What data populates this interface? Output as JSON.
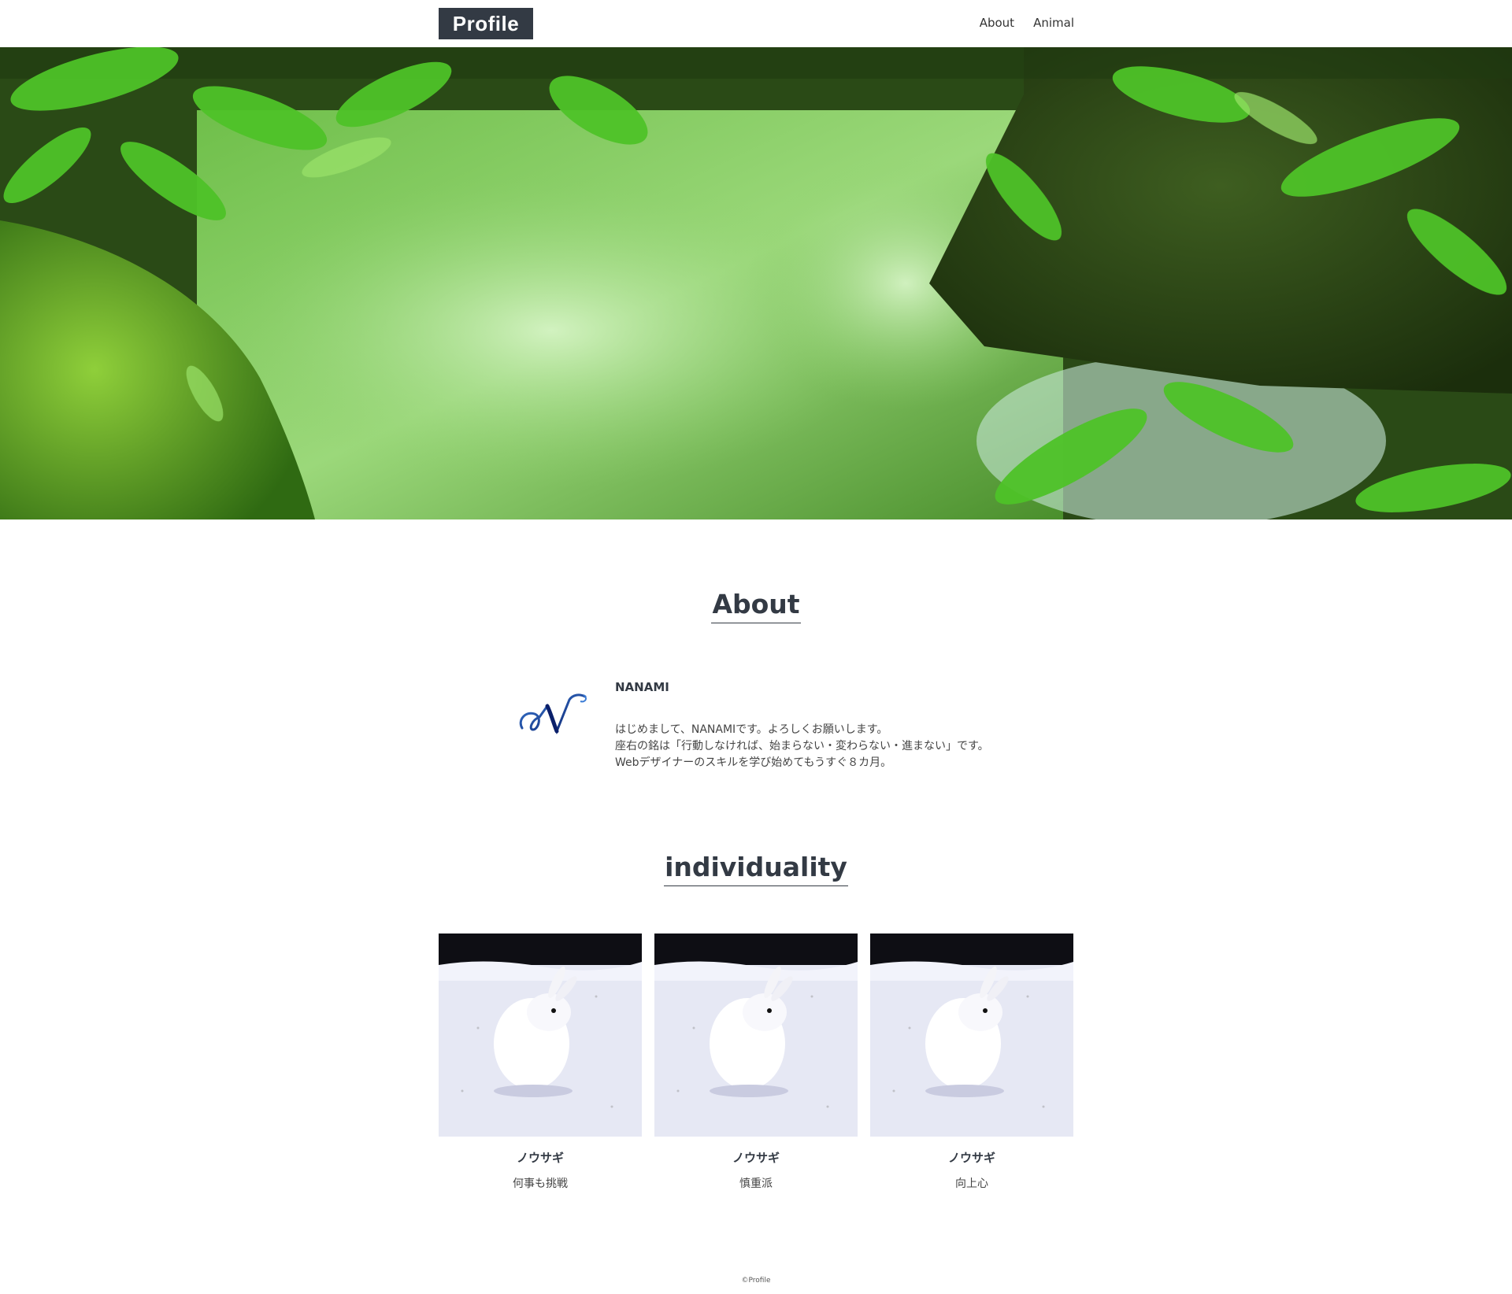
{
  "header": {
    "logo": "Profile",
    "nav": [
      "About",
      "Animal"
    ]
  },
  "about": {
    "heading": "About",
    "name": "NANAMI",
    "lines": [
      "はじめまして、NANAMIです。よろしくお願いします。",
      "座右の銘は「行動しなければ、始まらない・変わらない・進まない」です。",
      "Webデザイナーのスキルを学び始めてもうすぐ８カ月。"
    ]
  },
  "individuality": {
    "heading": "individuality",
    "cards": [
      {
        "title": "ノウサギ",
        "desc": "何事も挑戦"
      },
      {
        "title": "ノウサギ",
        "desc": "慎重派"
      },
      {
        "title": "ノウサギ",
        "desc": "向上心"
      }
    ]
  },
  "footer": {
    "copyright": "©Profile"
  },
  "colors": {
    "logo_bg": "#333a44",
    "text": "#333333",
    "hero_green": "#3d8a22"
  },
  "icons": {
    "about_logo": "script-letter-n-logo"
  }
}
